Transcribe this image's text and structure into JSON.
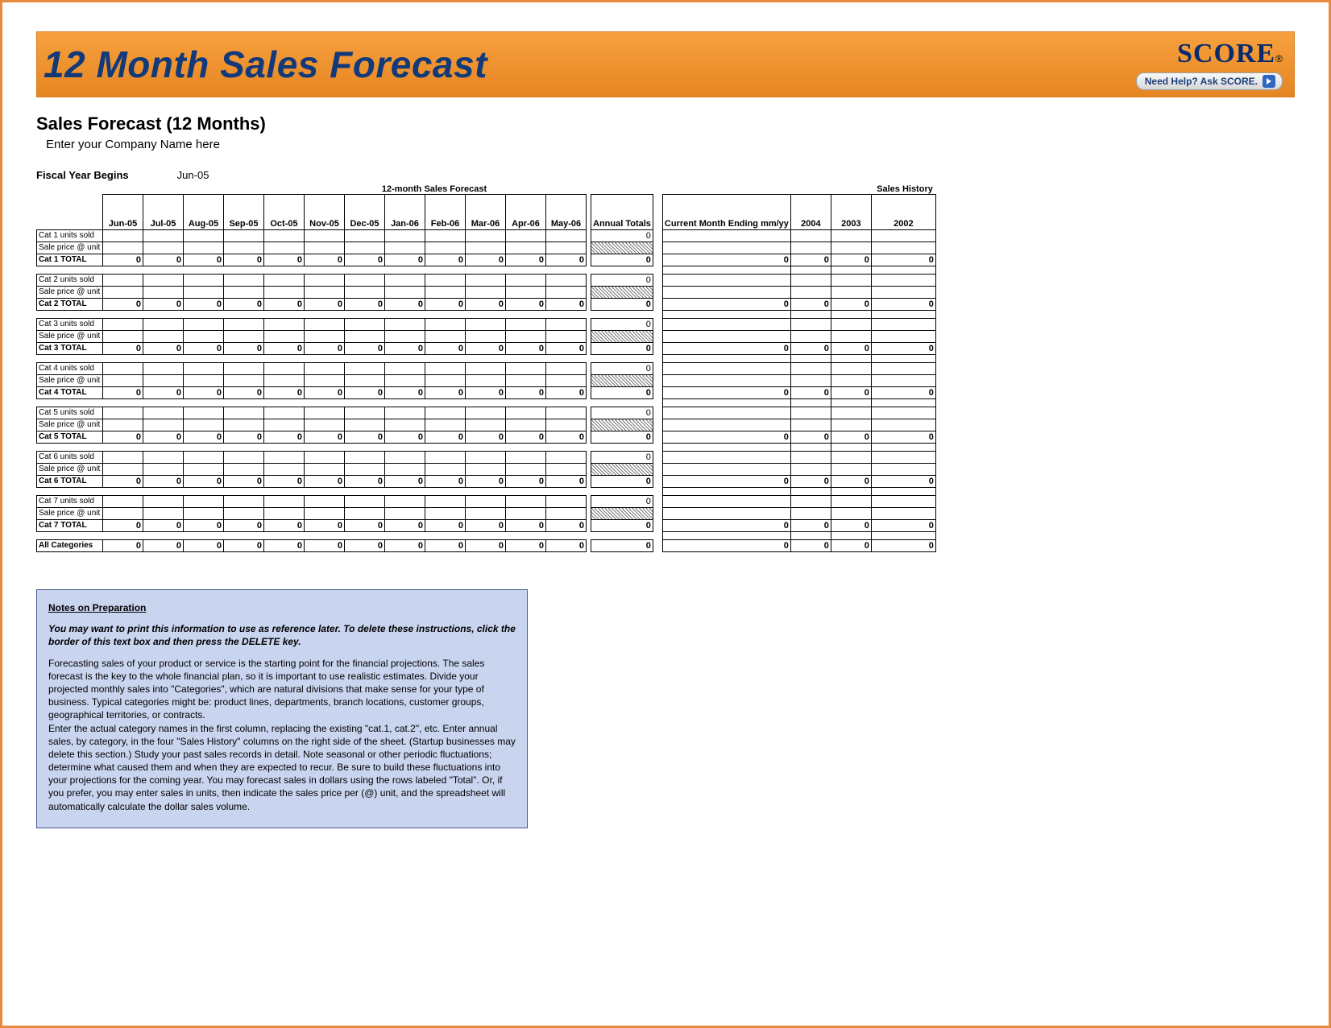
{
  "banner": {
    "title": "12 Month Sales Forecast",
    "score_logo": "SCORE",
    "score_reg": "®",
    "help_label": "Need Help? Ask SCORE."
  },
  "subheader": {
    "title": "Sales Forecast (12 Months)",
    "company_placeholder": "Enter your Company Name here",
    "fiscal_label": "Fiscal Year Begins",
    "fiscal_value": "Jun-05"
  },
  "section_labels": {
    "forecast": "12-month Sales Forecast",
    "history": "Sales History"
  },
  "months": [
    "Jun-05",
    "Jul-05",
    "Aug-05",
    "Sep-05",
    "Oct-05",
    "Nov-05",
    "Dec-05",
    "Jan-06",
    "Feb-06",
    "Mar-06",
    "Apr-06",
    "May-06"
  ],
  "annual_header": "Annual Totals",
  "history_headers": {
    "current": "Current Month Ending mm/yy",
    "y2004": "2004",
    "y2003": "2003",
    "y2002": "2002"
  },
  "categories": [
    {
      "units_label": "Cat 1 units sold",
      "price_label": "Sale price @ unit",
      "total_label": "Cat 1 TOTAL",
      "annual": "0",
      "monthly_totals": [
        "0",
        "0",
        "0",
        "0",
        "0",
        "0",
        "0",
        "0",
        "0",
        "0",
        "0",
        "0"
      ],
      "history_totals": [
        "0",
        "0",
        "0",
        "0"
      ]
    },
    {
      "units_label": "Cat 2 units sold",
      "price_label": "Sale price @ unit",
      "total_label": "Cat 2 TOTAL",
      "annual": "0",
      "monthly_totals": [
        "0",
        "0",
        "0",
        "0",
        "0",
        "0",
        "0",
        "0",
        "0",
        "0",
        "0",
        "0"
      ],
      "history_totals": [
        "0",
        "0",
        "0",
        "0"
      ]
    },
    {
      "units_label": "Cat 3 units sold",
      "price_label": "Sale price @ unit",
      "total_label": "Cat 3 TOTAL",
      "annual": "0",
      "monthly_totals": [
        "0",
        "0",
        "0",
        "0",
        "0",
        "0",
        "0",
        "0",
        "0",
        "0",
        "0",
        "0"
      ],
      "history_totals": [
        "0",
        "0",
        "0",
        "0"
      ]
    },
    {
      "units_label": "Cat 4 units sold",
      "price_label": "Sale price @ unit",
      "total_label": "Cat 4 TOTAL",
      "annual": "0",
      "monthly_totals": [
        "0",
        "0",
        "0",
        "0",
        "0",
        "0",
        "0",
        "0",
        "0",
        "0",
        "0",
        "0"
      ],
      "history_totals": [
        "0",
        "0",
        "0",
        "0"
      ]
    },
    {
      "units_label": "Cat 5 units sold",
      "price_label": "Sale price @ unit",
      "total_label": "Cat 5 TOTAL",
      "annual": "0",
      "monthly_totals": [
        "0",
        "0",
        "0",
        "0",
        "0",
        "0",
        "0",
        "0",
        "0",
        "0",
        "0",
        "0"
      ],
      "history_totals": [
        "0",
        "0",
        "0",
        "0"
      ]
    },
    {
      "units_label": "Cat 6 units sold",
      "price_label": "Sale price @ unit",
      "total_label": "Cat 6 TOTAL",
      "annual": "0",
      "monthly_totals": [
        "0",
        "0",
        "0",
        "0",
        "0",
        "0",
        "0",
        "0",
        "0",
        "0",
        "0",
        "0"
      ],
      "history_totals": [
        "0",
        "0",
        "0",
        "0"
      ]
    },
    {
      "units_label": "Cat 7 units sold",
      "price_label": "Sale price @ unit",
      "total_label": "Cat 7 TOTAL",
      "annual": "0",
      "monthly_totals": [
        "0",
        "0",
        "0",
        "0",
        "0",
        "0",
        "0",
        "0",
        "0",
        "0",
        "0",
        "0"
      ],
      "history_totals": [
        "0",
        "0",
        "0",
        "0"
      ]
    }
  ],
  "all_cats": {
    "label": "All Categories",
    "monthly_totals": [
      "0",
      "0",
      "0",
      "0",
      "0",
      "0",
      "0",
      "0",
      "0",
      "0",
      "0",
      "0"
    ],
    "annual": "0",
    "history_totals": [
      "0",
      "0",
      "0",
      "0"
    ]
  },
  "notes": {
    "title": "Notes on Preparation",
    "lead": "You may want to print this information to use as reference later. To delete these instructions, click the border of this text box and then press the DELETE key.",
    "p1": "Forecasting sales of your product or service is the starting point for the financial projections. The sales forecast is the key to the whole financial plan, so it is important to use realistic estimates. Divide your projected monthly sales into \"Categories\", which are natural divisions that make sense for your type of business. Typical categories might be: product lines, departments, branch locations, customer groups, geographical territories, or contracts.",
    "p2": "Enter the actual category names in the first column, replacing the existing \"cat.1, cat.2\", etc. Enter annual sales, by category, in the four \"Sales History\" columns on the right side of the sheet. (Startup businesses may delete this section.) Study your past sales records in detail. Note seasonal or other periodic fluctuations; determine what caused them and when they are expected to recur. Be sure to build these fluctuations into your projections for the coming year. You may forecast sales in dollars using the rows labeled \"Total\".  Or, if you prefer, you may enter sales in units, then indicate the sales price per (@) unit, and the spreadsheet will automatically calculate the dollar sales volume."
  }
}
